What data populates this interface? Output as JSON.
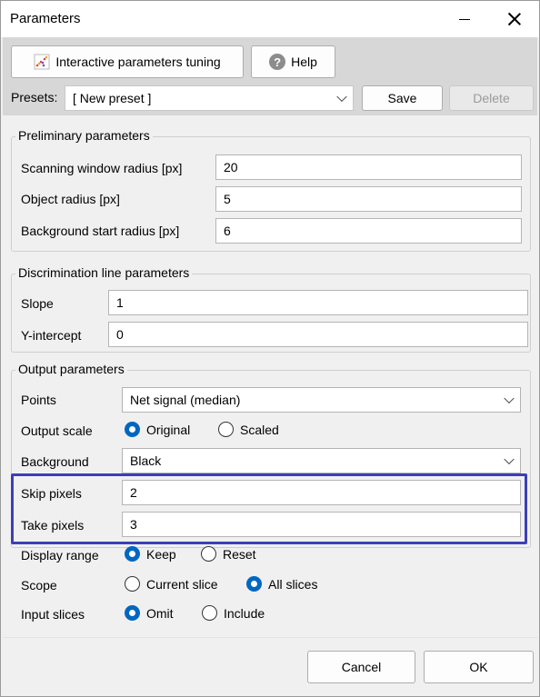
{
  "window": {
    "title": "Parameters"
  },
  "toolbar": {
    "interactive_label": "Interactive parameters tuning",
    "help_label": "Help",
    "help_icon": "?",
    "presets_label": "Presets:",
    "presets_value": "[ New preset ]",
    "save_label": "Save",
    "delete_label": "Delete"
  },
  "preliminary": {
    "title": "Preliminary parameters",
    "fields": [
      {
        "label": "Scanning window radius [px]",
        "value": "20"
      },
      {
        "label": "Object radius [px]",
        "value": "5"
      },
      {
        "label": "Background start radius [px]",
        "value": "6"
      }
    ]
  },
  "discrimination": {
    "title": "Discrimination line parameters",
    "fields": [
      {
        "label": "Slope",
        "value": "1"
      },
      {
        "label": "Y-intercept",
        "value": "0"
      }
    ]
  },
  "output": {
    "title": "Output parameters",
    "points_label": "Points",
    "points_value": "Net signal (median)",
    "scale_label": "Output scale",
    "scale_options": [
      "Original",
      "Scaled"
    ],
    "scale_selected": "Original",
    "background_label": "Background",
    "background_value": "Black",
    "skip_label": "Skip pixels",
    "skip_value": "2",
    "take_label": "Take pixels",
    "take_value": "3"
  },
  "extra": {
    "display_label": "Display range",
    "display_options": [
      "Keep",
      "Reset"
    ],
    "display_selected": "Keep",
    "scope_label": "Scope",
    "scope_options": [
      "Current slice",
      "All slices"
    ],
    "scope_selected": "All slices",
    "input_label": "Input slices",
    "input_options": [
      "Omit",
      "Include"
    ],
    "input_selected": "Omit"
  },
  "footer": {
    "cancel_label": "Cancel",
    "ok_label": "OK"
  },
  "colors": {
    "highlight": "#3c3fb8",
    "radio_on": "#0067c0"
  }
}
